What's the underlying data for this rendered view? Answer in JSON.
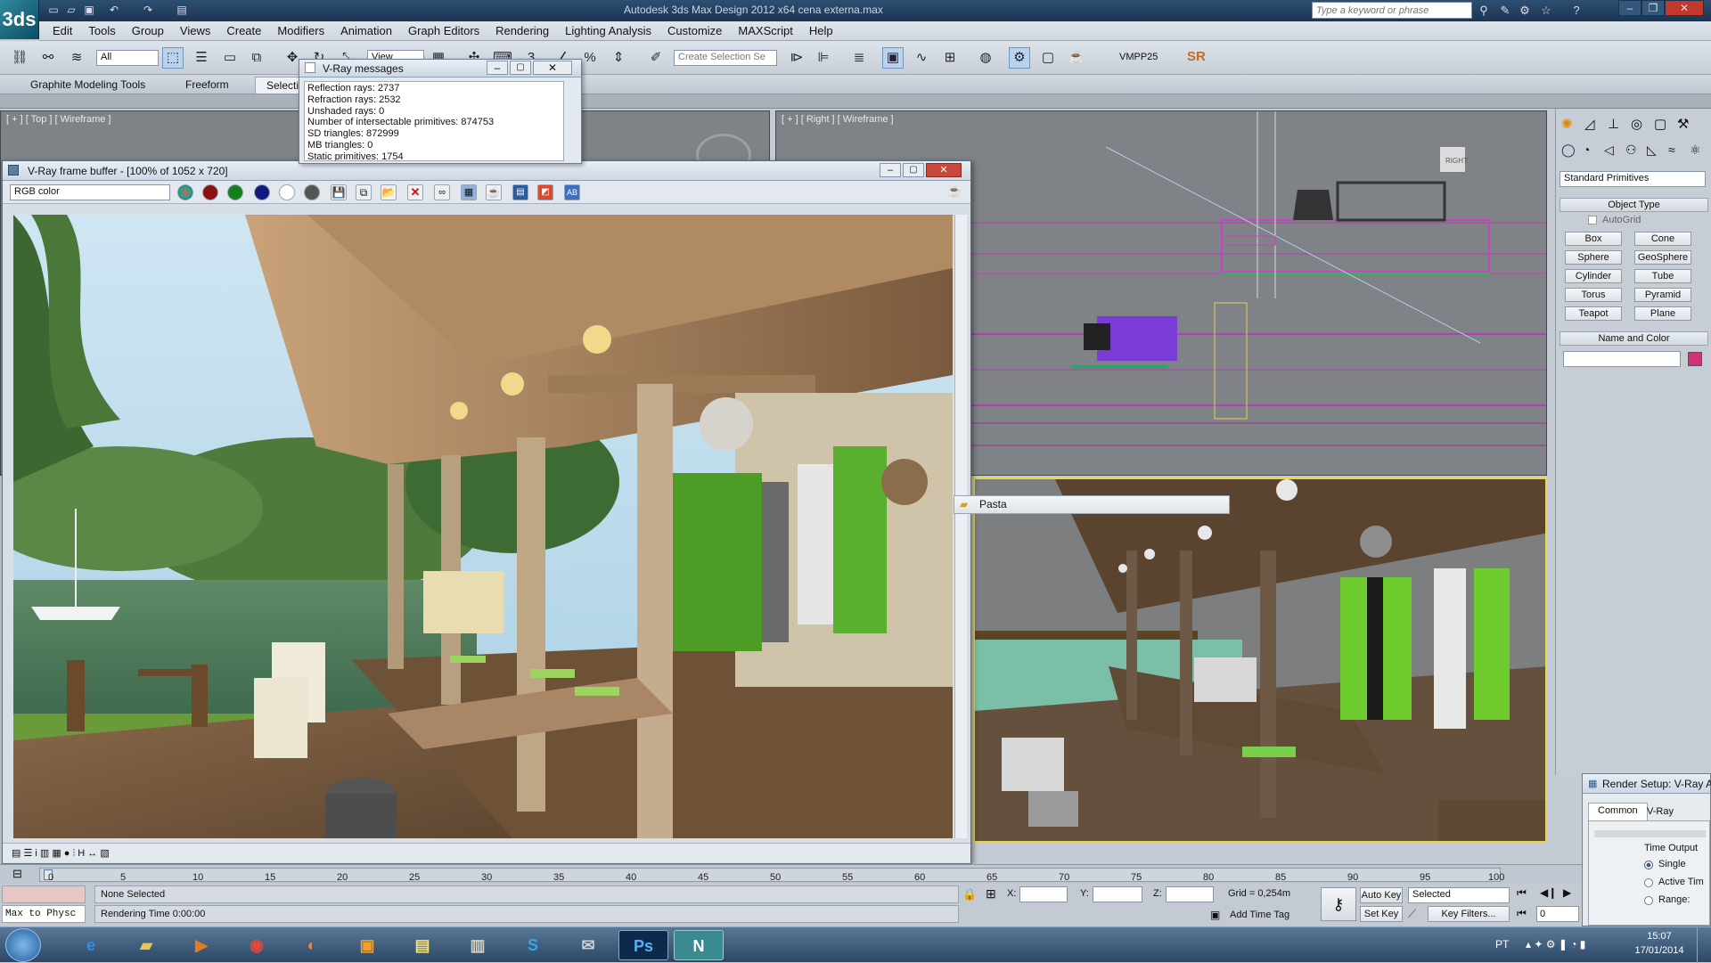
{
  "window": {
    "app_title": "Autodesk 3ds Max Design 2012 x64    cena externa.max",
    "search_placeholder": "Type a keyword or phrase",
    "logo": "3ds"
  },
  "menu": [
    "Edit",
    "Tools",
    "Group",
    "Views",
    "Create",
    "Modifiers",
    "Animation",
    "Graph Editors",
    "Rendering",
    "Lighting Analysis",
    "Customize",
    "MAXScript",
    "Help"
  ],
  "toolbar": {
    "filter_value": "All",
    "view_value": "View",
    "selection_set_placeholder": "Create Selection Se",
    "vmpp": "VMPP25",
    "sr": "SR"
  },
  "ribbon": {
    "tabs": [
      "Graphite Modeling Tools",
      "Freeform",
      "Selecti"
    ]
  },
  "viewports": {
    "top_label": "[ + ] [ Top ] [ Wireframe ]",
    "right_label": "[ + ] [ Right ] [ Wireframe ]",
    "viewcube_label": "RIGHT"
  },
  "vray_messages": {
    "title": "V-Ray messages",
    "lines": [
      "Reflection rays: 2737",
      "Refraction rays: 2532",
      "Unshaded rays: 0",
      "Number of intersectable primitives: 874753",
      "SD triangles: 872999",
      "MB triangles: 0",
      "Static primitives: 1754"
    ]
  },
  "vfb": {
    "title": "V-Ray frame buffer - [100% of 1052 x 720]",
    "channel": "RGB color"
  },
  "pasta": "Pasta",
  "command_panel": {
    "category": "Standard Primitives",
    "object_type_header": "Object Type",
    "autogrid": "AutoGrid",
    "buttons": [
      "Box",
      "Cone",
      "Sphere",
      "GeoSphere",
      "Cylinder",
      "Tube",
      "Torus",
      "Pyramid",
      "Teapot",
      "Plane"
    ],
    "name_color_header": "Name and Color",
    "object_color": "#d1307a"
  },
  "timeline": {
    "ticks": [
      "0",
      "5",
      "10",
      "15",
      "20",
      "25",
      "30",
      "35",
      "40",
      "45",
      "50",
      "55",
      "60",
      "65",
      "70",
      "75",
      "80",
      "85",
      "90",
      "95",
      "100"
    ]
  },
  "status": {
    "script_label": "Max to Physc",
    "selection": "None Selected",
    "rendering_time": "Rendering Time  0:00:00",
    "x_label": "X:",
    "y_label": "Y:",
    "z_label": "Z:",
    "grid": "Grid = 0,254m",
    "add_time_tag": "Add Time Tag",
    "auto_key": "Auto Key",
    "set_key": "Set Key",
    "key_mode": "Selected",
    "key_filters": "Key Filters...",
    "frame": "0"
  },
  "render_setup": {
    "title": "Render Setup: V-Ray A",
    "tabs": [
      "Common",
      "V-Ray"
    ],
    "time_output": "Time Output",
    "options": [
      "Single",
      "Active Tim",
      "Range:"
    ]
  },
  "taskbar": {
    "language": "PT",
    "time": "15:07",
    "date": "17/01/2014",
    "apps": [
      "IE",
      "Folder",
      "Media",
      "Chrome",
      "Firefox",
      "Player",
      "Notes",
      "Explorer",
      "Skype",
      "Mail",
      "Ps",
      "3ds"
    ]
  }
}
